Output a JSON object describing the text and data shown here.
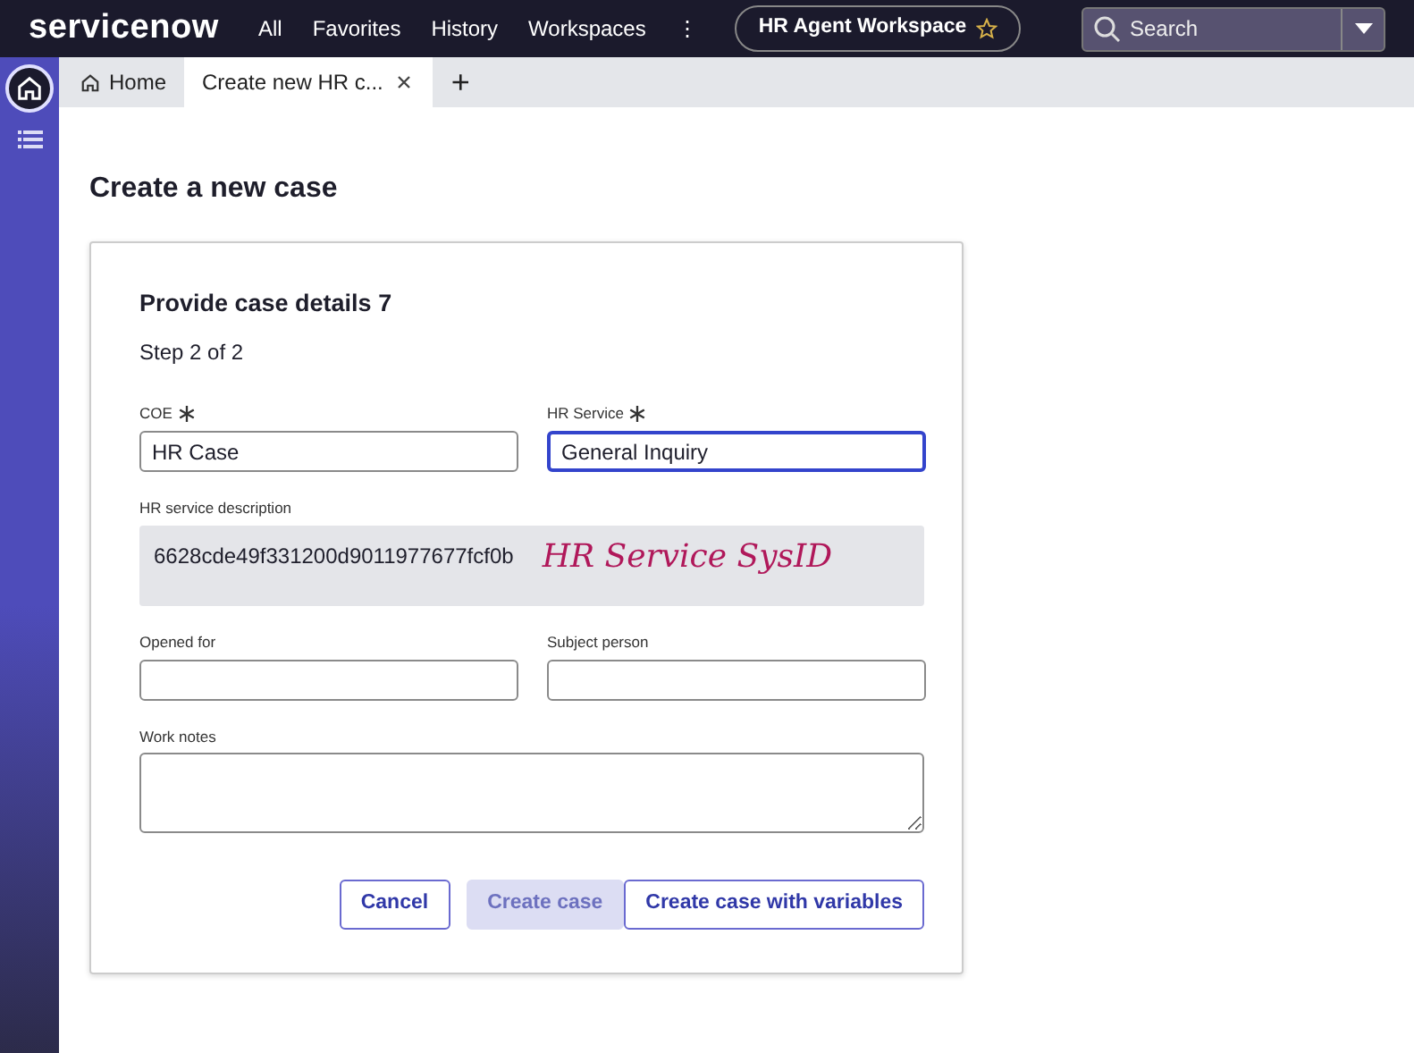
{
  "header": {
    "logo": "servicenow",
    "menu": [
      {
        "label": "All"
      },
      {
        "label": "Favorites"
      },
      {
        "label": "History"
      },
      {
        "label": "Workspaces"
      }
    ],
    "more": "⋮",
    "workspace": {
      "label": "HR Agent Workspace",
      "starred": false
    },
    "search": {
      "placeholder": "Search"
    }
  },
  "tabs": [
    {
      "label": "Home",
      "selected": false
    },
    {
      "label": "Create new HR c...",
      "selected": true
    }
  ],
  "new_tab": "+",
  "page_title": "Create a new case",
  "form": {
    "title": "Provide case details 7",
    "step": "Step 2 of 2",
    "rows": [
      [
        {
          "label": "COE",
          "required": true,
          "value": "HR Case",
          "kind": "input"
        },
        {
          "label": "HR Service",
          "required": true,
          "value": "General Inquiry",
          "kind": "input",
          "focused": true
        }
      ],
      [
        {
          "label": "HR service description",
          "value": "6628cde49f331200d9011977677fcf0b",
          "kind": "readonly",
          "annotation": "HR Service SysID"
        }
      ],
      [
        {
          "label": "Opened for",
          "kind": "input"
        },
        {
          "label": "Subject person",
          "kind": "input"
        }
      ],
      [
        {
          "label": "Work notes",
          "kind": "textarea"
        }
      ]
    ],
    "buttons": [
      {
        "label": "Cancel",
        "disabled": false
      },
      {
        "label": "Create case",
        "disabled": true
      },
      {
        "label": "Create case with variables",
        "disabled": false
      }
    ]
  }
}
